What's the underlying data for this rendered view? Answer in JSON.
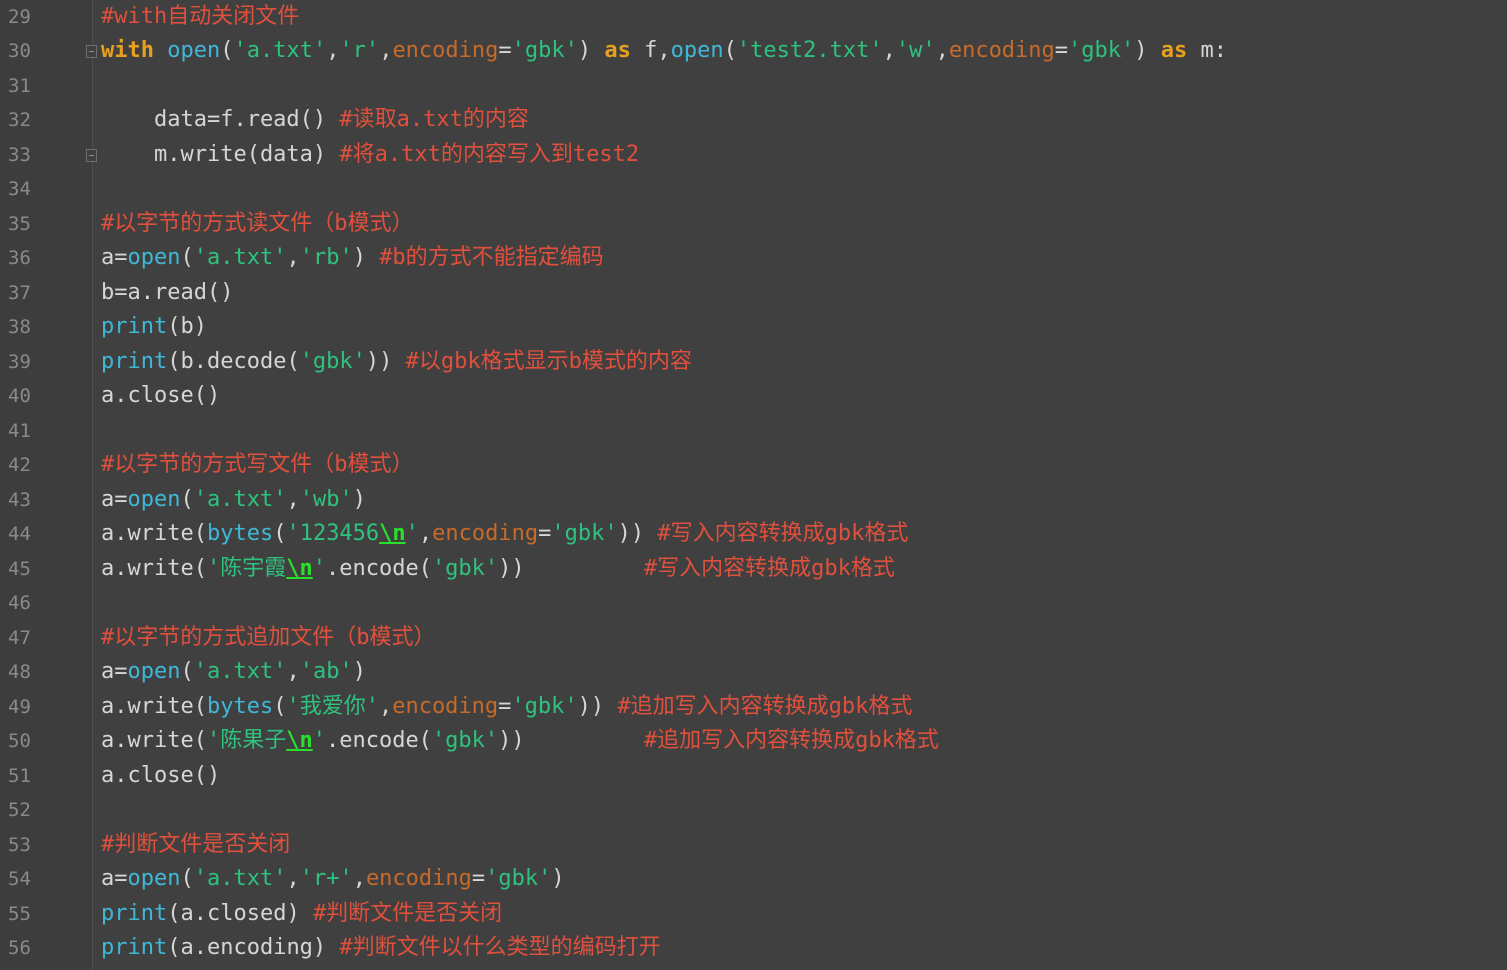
{
  "editor": {
    "lines": [
      {
        "n": "29",
        "tokens": [
          {
            "t": "cm",
            "v": "#with自动关闭文件"
          }
        ]
      },
      {
        "n": "30",
        "tokens": [
          {
            "t": "kw",
            "v": "with "
          },
          {
            "t": "bi",
            "v": "open"
          },
          {
            "t": "txt",
            "v": "("
          },
          {
            "t": "str",
            "v": "'a.txt'"
          },
          {
            "t": "txt",
            "v": ","
          },
          {
            "t": "str",
            "v": "'r'"
          },
          {
            "t": "txt",
            "v": ","
          },
          {
            "t": "kwarg",
            "v": "encoding"
          },
          {
            "t": "op",
            "v": "="
          },
          {
            "t": "str",
            "v": "'gbk'"
          },
          {
            "t": "txt",
            "v": ") "
          },
          {
            "t": "kw",
            "v": "as"
          },
          {
            "t": "txt",
            "v": " f,"
          },
          {
            "t": "bi",
            "v": "open"
          },
          {
            "t": "txt",
            "v": "("
          },
          {
            "t": "str",
            "v": "'test2.txt'"
          },
          {
            "t": "txt",
            "v": ","
          },
          {
            "t": "str",
            "v": "'w'"
          },
          {
            "t": "txt",
            "v": ","
          },
          {
            "t": "kwarg",
            "v": "encoding"
          },
          {
            "t": "op",
            "v": "="
          },
          {
            "t": "str",
            "v": "'gbk'"
          },
          {
            "t": "txt",
            "v": ") "
          },
          {
            "t": "kw",
            "v": "as"
          },
          {
            "t": "txt",
            "v": " m:"
          }
        ]
      },
      {
        "n": "31",
        "tokens": []
      },
      {
        "n": "32",
        "tokens": [
          {
            "t": "txt",
            "v": "    data=f.read() "
          },
          {
            "t": "cm",
            "v": "#读取a.txt的内容"
          }
        ]
      },
      {
        "n": "33",
        "tokens": [
          {
            "t": "txt",
            "v": "    m.write(data) "
          },
          {
            "t": "cm",
            "v": "#将a.txt的内容写入到test2"
          }
        ]
      },
      {
        "n": "34",
        "tokens": []
      },
      {
        "n": "35",
        "tokens": [
          {
            "t": "cm",
            "v": "#以字节的方式读文件（b模式）"
          }
        ]
      },
      {
        "n": "36",
        "tokens": [
          {
            "t": "txt",
            "v": "a="
          },
          {
            "t": "bi",
            "v": "open"
          },
          {
            "t": "txt",
            "v": "("
          },
          {
            "t": "str",
            "v": "'a.txt'"
          },
          {
            "t": "txt",
            "v": ","
          },
          {
            "t": "str",
            "v": "'rb'"
          },
          {
            "t": "txt",
            "v": ") "
          },
          {
            "t": "cm",
            "v": "#b的方式不能指定编码"
          }
        ]
      },
      {
        "n": "37",
        "tokens": [
          {
            "t": "txt",
            "v": "b=a.read()"
          }
        ]
      },
      {
        "n": "38",
        "tokens": [
          {
            "t": "bi",
            "v": "print"
          },
          {
            "t": "txt",
            "v": "(b)"
          }
        ]
      },
      {
        "n": "39",
        "tokens": [
          {
            "t": "bi",
            "v": "print"
          },
          {
            "t": "txt",
            "v": "(b.decode("
          },
          {
            "t": "str",
            "v": "'gbk'"
          },
          {
            "t": "txt",
            "v": ")) "
          },
          {
            "t": "cm",
            "v": "#以gbk格式显示b模式的内容"
          }
        ]
      },
      {
        "n": "40",
        "tokens": [
          {
            "t": "txt",
            "v": "a.close()"
          }
        ]
      },
      {
        "n": "41",
        "tokens": []
      },
      {
        "n": "42",
        "tokens": [
          {
            "t": "cm",
            "v": "#以字节的方式写文件（b模式）"
          }
        ]
      },
      {
        "n": "43",
        "tokens": [
          {
            "t": "txt",
            "v": "a="
          },
          {
            "t": "bi",
            "v": "open"
          },
          {
            "t": "txt",
            "v": "("
          },
          {
            "t": "str",
            "v": "'a.txt'"
          },
          {
            "t": "txt",
            "v": ","
          },
          {
            "t": "str",
            "v": "'wb'"
          },
          {
            "t": "txt",
            "v": ")"
          }
        ]
      },
      {
        "n": "44",
        "tokens": [
          {
            "t": "txt",
            "v": "a.write("
          },
          {
            "t": "bi",
            "v": "bytes"
          },
          {
            "t": "txt",
            "v": "("
          },
          {
            "t": "str",
            "v": "'123456"
          },
          {
            "t": "esc",
            "v": "\\n"
          },
          {
            "t": "str",
            "v": "'"
          },
          {
            "t": "txt",
            "v": ","
          },
          {
            "t": "kwarg",
            "v": "encoding"
          },
          {
            "t": "op",
            "v": "="
          },
          {
            "t": "str",
            "v": "'gbk'"
          },
          {
            "t": "txt",
            "v": ")) "
          },
          {
            "t": "cm",
            "v": "#写入内容转换成gbk格式"
          }
        ]
      },
      {
        "n": "45",
        "tokens": [
          {
            "t": "txt",
            "v": "a.write("
          },
          {
            "t": "str",
            "v": "'陈宇霞"
          },
          {
            "t": "esc",
            "v": "\\n"
          },
          {
            "t": "str",
            "v": "'"
          },
          {
            "t": "txt",
            "v": ".encode("
          },
          {
            "t": "str",
            "v": "'gbk'"
          },
          {
            "t": "txt",
            "v": "))         "
          },
          {
            "t": "cm",
            "v": "#写入内容转换成gbk格式"
          }
        ]
      },
      {
        "n": "46",
        "tokens": []
      },
      {
        "n": "47",
        "tokens": [
          {
            "t": "cm",
            "v": "#以字节的方式追加文件（b模式）"
          }
        ]
      },
      {
        "n": "48",
        "tokens": [
          {
            "t": "txt",
            "v": "a="
          },
          {
            "t": "bi",
            "v": "open"
          },
          {
            "t": "txt",
            "v": "("
          },
          {
            "t": "str",
            "v": "'a.txt'"
          },
          {
            "t": "txt",
            "v": ","
          },
          {
            "t": "str",
            "v": "'ab'"
          },
          {
            "t": "txt",
            "v": ")"
          }
        ]
      },
      {
        "n": "49",
        "tokens": [
          {
            "t": "txt",
            "v": "a.write("
          },
          {
            "t": "bi",
            "v": "bytes"
          },
          {
            "t": "txt",
            "v": "("
          },
          {
            "t": "str",
            "v": "'我爱你'"
          },
          {
            "t": "txt",
            "v": ","
          },
          {
            "t": "kwarg",
            "v": "encoding"
          },
          {
            "t": "op",
            "v": "="
          },
          {
            "t": "str",
            "v": "'gbk'"
          },
          {
            "t": "txt",
            "v": ")) "
          },
          {
            "t": "cm",
            "v": "#追加写入内容转换成gbk格式"
          }
        ]
      },
      {
        "n": "50",
        "tokens": [
          {
            "t": "txt",
            "v": "a.write("
          },
          {
            "t": "str",
            "v": "'陈果子"
          },
          {
            "t": "esc",
            "v": "\\n"
          },
          {
            "t": "str",
            "v": "'"
          },
          {
            "t": "txt",
            "v": ".encode("
          },
          {
            "t": "str",
            "v": "'gbk'"
          },
          {
            "t": "txt",
            "v": "))         "
          },
          {
            "t": "cm",
            "v": "#追加写入内容转换成gbk格式"
          }
        ]
      },
      {
        "n": "51",
        "tokens": [
          {
            "t": "txt",
            "v": "a.close()"
          }
        ]
      },
      {
        "n": "52",
        "tokens": []
      },
      {
        "n": "53",
        "tokens": [
          {
            "t": "cm",
            "v": "#判断文件是否关闭"
          }
        ]
      },
      {
        "n": "54",
        "tokens": [
          {
            "t": "txt",
            "v": "a="
          },
          {
            "t": "bi",
            "v": "open"
          },
          {
            "t": "txt",
            "v": "("
          },
          {
            "t": "str",
            "v": "'a.txt'"
          },
          {
            "t": "txt",
            "v": ","
          },
          {
            "t": "str",
            "v": "'r+'"
          },
          {
            "t": "txt",
            "v": ","
          },
          {
            "t": "kwarg",
            "v": "encoding"
          },
          {
            "t": "op",
            "v": "="
          },
          {
            "t": "str",
            "v": "'gbk'"
          },
          {
            "t": "txt",
            "v": ")"
          }
        ]
      },
      {
        "n": "55",
        "tokens": [
          {
            "t": "bi",
            "v": "print"
          },
          {
            "t": "txt",
            "v": "(a.closed) "
          },
          {
            "t": "cm",
            "v": "#判断文件是否关闭"
          }
        ]
      },
      {
        "n": "56",
        "tokens": [
          {
            "t": "bi",
            "v": "print"
          },
          {
            "t": "txt",
            "v": "(a.encoding) "
          },
          {
            "t": "cm",
            "v": "#判断文件以什么类型的编码打开"
          }
        ]
      }
    ],
    "fold_markers": [
      "30",
      "33"
    ],
    "colors": {
      "background": "#404040",
      "keyword": "#e6a01f",
      "builtin": "#3fb8d8",
      "string": "#2ec27e",
      "escape": "#29e029",
      "kwarg": "#c76a2a",
      "comment": "#e0503c",
      "text": "#d6d6d6",
      "line_number": "#8a8a8a"
    }
  }
}
